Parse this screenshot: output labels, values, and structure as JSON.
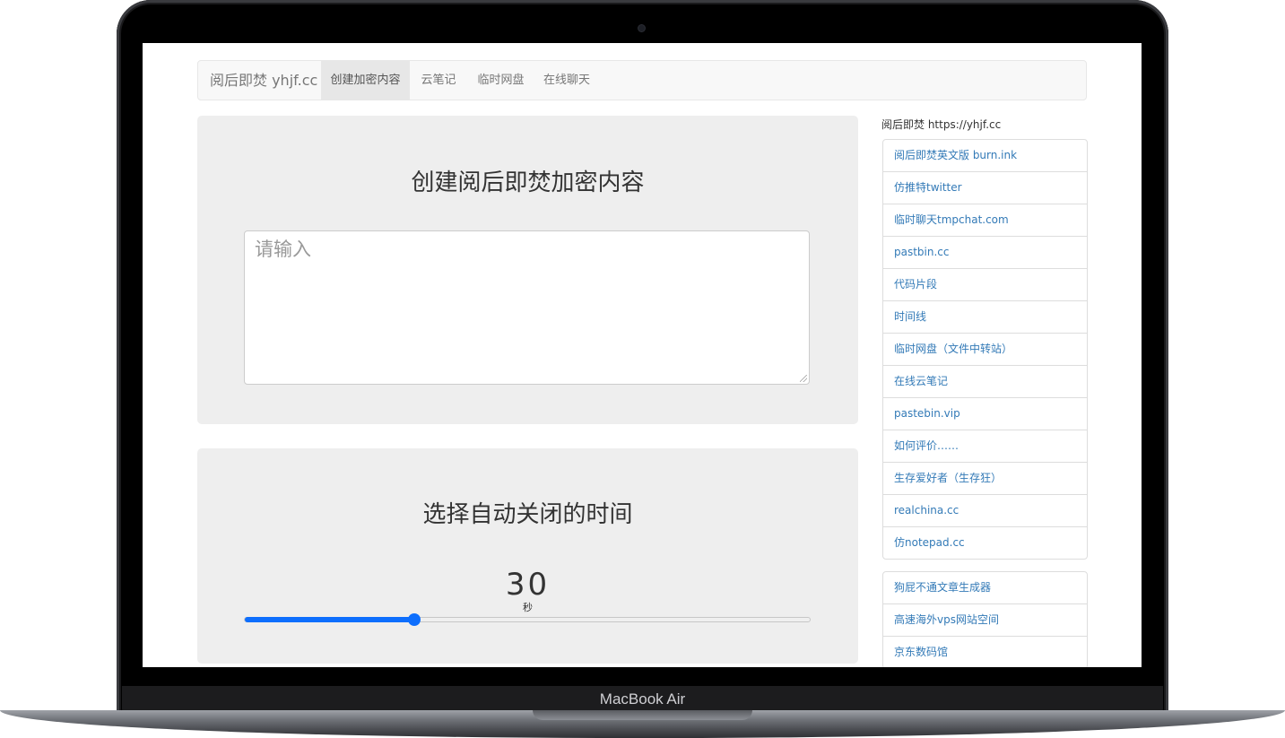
{
  "device": {
    "label": "MacBook Air"
  },
  "navbar": {
    "brand": "阅后即焚 yhjf.cc",
    "tabs": [
      {
        "label": "创建加密内容",
        "active": true
      },
      {
        "label": "云笔记",
        "active": false
      },
      {
        "label": "临时网盘",
        "active": false
      },
      {
        "label": "在线聊天",
        "active": false
      }
    ]
  },
  "create_panel": {
    "title": "创建阅后即焚加密内容",
    "textarea_placeholder": "请输入"
  },
  "timer_panel": {
    "title": "选择自动关闭的时间",
    "value": "30",
    "unit": "秒",
    "slider_fraction": 0.3
  },
  "sidebar": {
    "heading": "阅后即焚 https://yhjf.cc",
    "links": [
      "阅后即焚英文版 burn.ink",
      "仿推特twitter",
      "临时聊天tmpchat.com",
      "pastbin.cc",
      "代码片段",
      "时间线",
      "临时网盘（文件中转站）",
      "在线云笔记",
      "pastebin.vip",
      "如何评价……",
      "生存爱好者（生存狂）",
      "realchina.cc",
      "仿notepad.cc"
    ],
    "links2": [
      "狗屁不通文章生成器",
      "高速海外vps网站空间",
      "京东数码馆"
    ]
  },
  "colors": {
    "accent": "#0d6efd",
    "link": "#337ab7",
    "panel_bg": "#eeeeee"
  }
}
